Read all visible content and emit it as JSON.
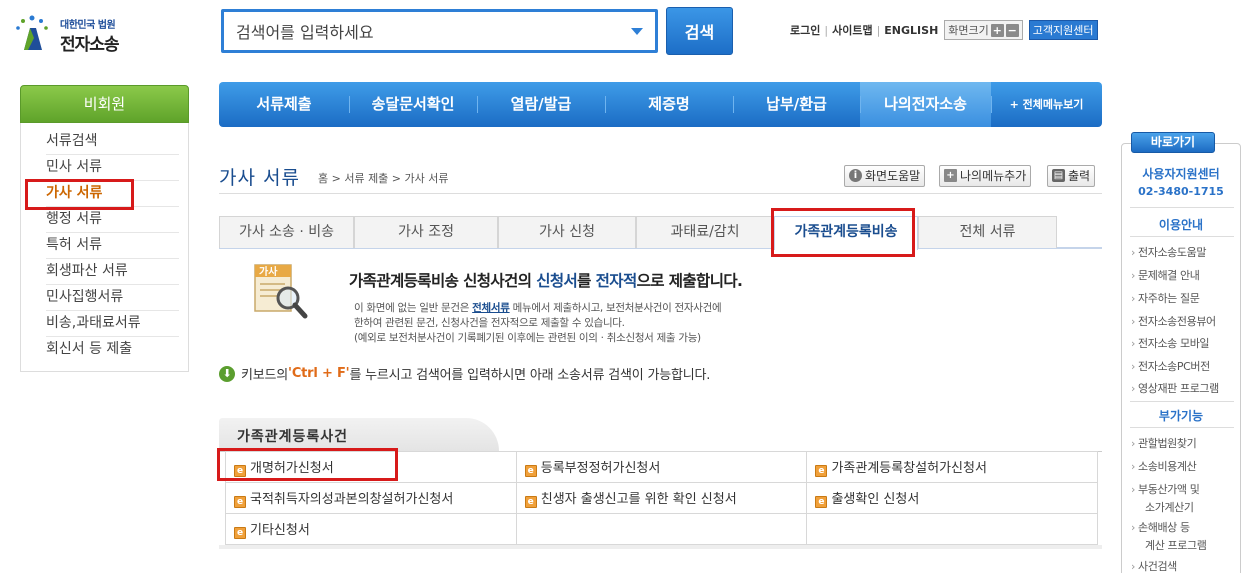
{
  "logo": {
    "line1": "대한민국 법원",
    "line2": "전자소송"
  },
  "search": {
    "placeholder": "검색어를 입력하세요",
    "button": "검색"
  },
  "util": {
    "login": "로그인",
    "sitemap": "사이트맵",
    "english": "ENGLISH",
    "screen_size": "화면크기",
    "zoom_in": "+",
    "zoom_out": "−",
    "support_center": "고객지원센터"
  },
  "sidebar": {
    "header": "비회원",
    "items": [
      {
        "label": "서류검색"
      },
      {
        "label": "민사 서류"
      },
      {
        "label": "가사 서류"
      },
      {
        "label": "행정 서류"
      },
      {
        "label": "특허 서류"
      },
      {
        "label": "회생파산 서류"
      },
      {
        "label": "민사집행서류"
      },
      {
        "label": "비송,과태료서류"
      },
      {
        "label": "회신서 등 제출"
      }
    ],
    "active_index": 2
  },
  "nav": {
    "tabs": [
      {
        "label": "서류제출"
      },
      {
        "label": "송달문서확인"
      },
      {
        "label": "열람/발급"
      },
      {
        "label": "제증명"
      },
      {
        "label": "납부/환급"
      },
      {
        "label": "나의전자소송"
      },
      {
        "label": "+ 전체메뉴보기"
      }
    ]
  },
  "page": {
    "title": "가사 서류",
    "breadcrumb": "홈 > 서류 제출 > 가사 서류",
    "help_button": "화면도움말",
    "add_menu_button": "나의메뉴추가",
    "print_button": "출력"
  },
  "subtabs": [
    {
      "label": "가사 소송 · 비송"
    },
    {
      "label": "가사 조정"
    },
    {
      "label": "가사 신청"
    },
    {
      "label": "과태료/감치"
    },
    {
      "label": "가족관계등록비송"
    },
    {
      "label": "전체 서류"
    }
  ],
  "intro": {
    "icon_label": "가사",
    "title_pre": "가족관계등록비송 신청사건의 ",
    "title_hl1": "신청서",
    "title_mid": "를 ",
    "title_hl2": "전자적",
    "title_post": "으로 제출합니다.",
    "desc1_pre": "이 화면에 없는 일반 문건은 ",
    "desc1_link": "전체서류",
    "desc1_post": " 메뉴에서 제출하시고, 보전처분사건이 전자사건에",
    "desc2": "한하여 관련된 문건, 신청사건을 전자적으로 제출할 수 있습니다.",
    "desc3": "(예외로 보전처분사건이 기록폐기된 이후에는 관련된 이의 · 취소신청서 제출 가능)"
  },
  "keyboard_tip": {
    "pre": "키보드의 ",
    "key": "'Ctrl + F'",
    "post": "를 누르시고 검색어를 입력하시면 아래 소송서류 검색이 가능합니다."
  },
  "cases": {
    "title": "가족관계등록사건",
    "rows": [
      [
        "개명허가신청서",
        "등록부정정허가신청서",
        "가족관계등록창설허가신청서"
      ],
      [
        "국적취득자의성과본의창설허가신청서",
        "친생자 출생신고를 위한 확인 신청서",
        "출생확인 신청서"
      ],
      [
        "기타신청서",
        "",
        ""
      ]
    ]
  },
  "quick": {
    "button": "바로가기",
    "center_title": "사용자지원센터",
    "center_phone": "02-3480-1715",
    "guide_title": "이용안내",
    "guide_items": [
      "전자소송도움말",
      "문제해결 안내",
      "자주하는 질문",
      "전자소송전용뷰어",
      "전자소송 모바일",
      "전자소송PC버전",
      "영상재판 프로그램"
    ],
    "features_title": "부가기능",
    "feature_items": [
      "관할법원찾기",
      "소송비용계산",
      "부동산가액 및",
      "소가계산기",
      "손해배상 등",
      "계산 프로그램",
      "사건검색"
    ]
  },
  "colors": {
    "brand_blue": "#1b6cc4",
    "member_green": "#6fb236",
    "highlight_red": "#d71a1a",
    "accent_orange": "#e06b18"
  }
}
